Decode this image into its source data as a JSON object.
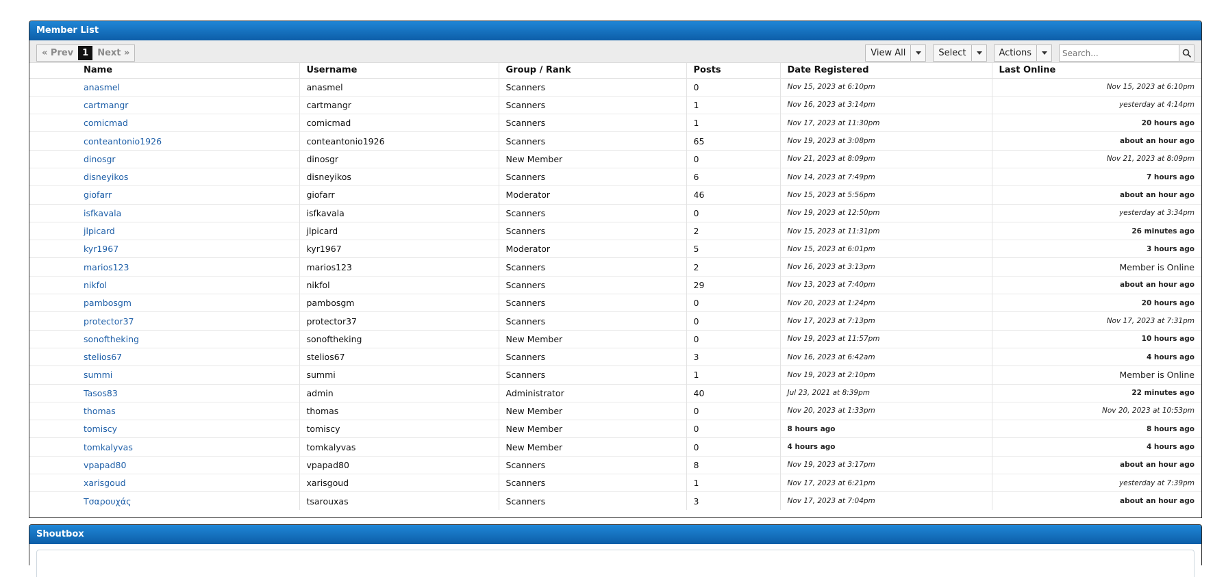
{
  "member_list": {
    "title": "Member List",
    "pager": {
      "prev": "« Prev",
      "current": "1",
      "next": "Next »"
    },
    "view_all": "View All",
    "select": "Select",
    "actions": "Actions",
    "search_placeholder": "Search...",
    "columns": [
      "Name",
      "Username",
      "Group / Rank",
      "Posts",
      "Date Registered",
      "Last Online"
    ],
    "rows": [
      {
        "name": "anasmel",
        "username": "anasmel",
        "group": "Scanners",
        "posts": "0",
        "registered": "Nov 15, 2023 at 6:10pm",
        "last_online": "Nov 15, 2023 at 6:10pm"
      },
      {
        "name": "cartmangr",
        "username": "cartmangr",
        "group": "Scanners",
        "posts": "1",
        "registered": "Nov 16, 2023 at 3:14pm",
        "last_online": "yesterday at 4:14pm"
      },
      {
        "name": "comicmad",
        "username": "comicmad",
        "group": "Scanners",
        "posts": "1",
        "registered": "Nov 17, 2023 at 11:30pm",
        "last_online": "20 hours ago"
      },
      {
        "name": "conteantonio1926",
        "username": "conteantonio1926",
        "group": "Scanners",
        "posts": "65",
        "registered": "Nov 19, 2023 at 3:08pm",
        "last_online": "about an hour ago"
      },
      {
        "name": "dinosgr",
        "username": "dinosgr",
        "group": "New Member",
        "posts": "0",
        "registered": "Nov 21, 2023 at 8:09pm",
        "last_online": "Nov 21, 2023 at 8:09pm"
      },
      {
        "name": "disneyikos",
        "username": "disneyikos",
        "group": "Scanners",
        "posts": "6",
        "registered": "Nov 14, 2023 at 7:49pm",
        "last_online": "7 hours ago"
      },
      {
        "name": "giofarr",
        "username": "giofarr",
        "group": "Moderator",
        "posts": "46",
        "registered": "Nov 15, 2023 at 5:56pm",
        "last_online": "about an hour ago"
      },
      {
        "name": "isfkavala",
        "username": "isfkavala",
        "group": "Scanners",
        "posts": "0",
        "registered": "Nov 19, 2023 at 12:50pm",
        "last_online": "yesterday at 3:34pm"
      },
      {
        "name": "jlpicard",
        "username": "jlpicard",
        "group": "Scanners",
        "posts": "2",
        "registered": "Nov 15, 2023 at 11:31pm",
        "last_online": "26 minutes ago"
      },
      {
        "name": "kyr1967",
        "username": "kyr1967",
        "group": "Moderator",
        "posts": "5",
        "registered": "Nov 15, 2023 at 6:01pm",
        "last_online": "3 hours ago"
      },
      {
        "name": "marios123",
        "username": "marios123",
        "group": "Scanners",
        "posts": "2",
        "registered": "Nov 16, 2023 at 3:13pm",
        "last_online": "Member is Online"
      },
      {
        "name": "nikfol",
        "username": "nikfol",
        "group": "Scanners",
        "posts": "29",
        "registered": "Nov 13, 2023 at 7:40pm",
        "last_online": "about an hour ago"
      },
      {
        "name": "pambosgm",
        "username": "pambosgm",
        "group": "Scanners",
        "posts": "0",
        "registered": "Nov 20, 2023 at 1:24pm",
        "last_online": "20 hours ago"
      },
      {
        "name": "protector37",
        "username": "protector37",
        "group": "Scanners",
        "posts": "0",
        "registered": "Nov 17, 2023 at 7:13pm",
        "last_online": "Nov 17, 2023 at 7:31pm"
      },
      {
        "name": "sonoftheking",
        "username": "sonoftheking",
        "group": "New Member",
        "posts": "0",
        "registered": "Nov 19, 2023 at 11:57pm",
        "last_online": "10 hours ago"
      },
      {
        "name": "stelios67",
        "username": "stelios67",
        "group": "Scanners",
        "posts": "3",
        "registered": "Nov 16, 2023 at 6:42am",
        "last_online": "4 hours ago"
      },
      {
        "name": "summi",
        "username": "summi",
        "group": "Scanners",
        "posts": "1",
        "registered": "Nov 19, 2023 at 2:10pm",
        "last_online": "Member is Online"
      },
      {
        "name": "Tasos83",
        "username": "admin",
        "group": "Administrator",
        "posts": "40",
        "registered": "Jul 23, 2021 at 8:39pm",
        "last_online": "22 minutes ago"
      },
      {
        "name": "thomas",
        "username": "thomas",
        "group": "New Member",
        "posts": "0",
        "registered": "Nov 20, 2023 at 1:33pm",
        "last_online": "Nov 20, 2023 at 10:53pm"
      },
      {
        "name": "tomiscy",
        "username": "tomiscy",
        "group": "New Member",
        "posts": "0",
        "registered": "8 hours ago",
        "last_online": "8 hours ago"
      },
      {
        "name": "tomkalyvas",
        "username": "tomkalyvas",
        "group": "New Member",
        "posts": "0",
        "registered": "4 hours ago",
        "last_online": "4 hours ago"
      },
      {
        "name": "vpapad80",
        "username": "vpapad80",
        "group": "Scanners",
        "posts": "8",
        "registered": "Nov 19, 2023 at 3:17pm",
        "last_online": "about an hour ago"
      },
      {
        "name": "xarisgoud",
        "username": "xarisgoud",
        "group": "Scanners",
        "posts": "1",
        "registered": "Nov 17, 2023 at 6:21pm",
        "last_online": "yesterday at 7:39pm"
      },
      {
        "name": "Τσαρουχάς",
        "username": "tsarouxas",
        "group": "Scanners",
        "posts": "3",
        "registered": "Nov 17, 2023 at 7:04pm",
        "last_online": "about an hour ago"
      }
    ]
  },
  "shoutbox": {
    "title": "Shoutbox"
  }
}
